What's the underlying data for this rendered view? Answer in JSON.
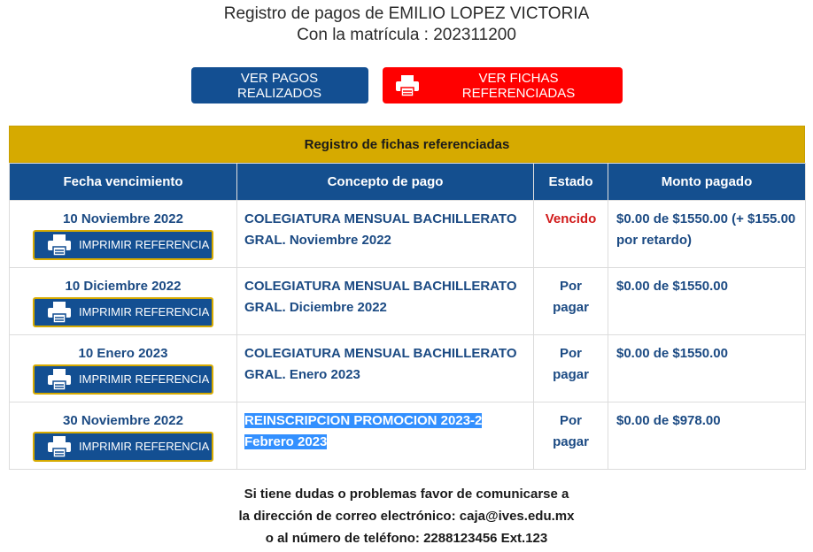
{
  "header": {
    "line1": "Registro de pagos de EMILIO LOPEZ VICTORIA",
    "line2": "Con la matrícula : 202311200"
  },
  "buttons": {
    "ver_pagos": "VER PAGOS REALIZADOS",
    "ver_fichas": "VER FICHAS REFERENCIADAS"
  },
  "table": {
    "caption": "Registro de fichas referenciadas",
    "columns": [
      "Fecha vencimiento",
      "Concepto de pago",
      "Estado",
      "Monto pagado"
    ],
    "print_label": "IMPRIMIR REFERENCIA",
    "rows": [
      {
        "fecha": "10 Noviembre 2022",
        "concepto_1": "COLEGIATURA MENSUAL BACHILLERATO",
        "concepto_2": "GRAL. Noviembre 2022",
        "estado": "Vencido",
        "estado_2": "",
        "monto": "$0.00 de $1550.00 (+ $155.00 por retardo)"
      },
      {
        "fecha": "10 Diciembre 2022",
        "concepto_1": "COLEGIATURA MENSUAL BACHILLERATO",
        "concepto_2": "GRAL. Diciembre 2022",
        "estado": "Por",
        "estado_2": "pagar",
        "monto": "$0.00 de $1550.00"
      },
      {
        "fecha": "10 Enero 2023",
        "concepto_1": "COLEGIATURA MENSUAL BACHILLERATO",
        "concepto_2": "GRAL. Enero 2023",
        "estado": "Por",
        "estado_2": "pagar",
        "monto": "$0.00 de $1550.00"
      },
      {
        "fecha": "30 Noviembre 2022",
        "concepto_1": "REINSCRIPCION PROMOCION 2023-2",
        "concepto_2": "Febrero 2023",
        "estado": "Por",
        "estado_2": "pagar",
        "monto": "$0.00 de $978.00"
      }
    ]
  },
  "footer": {
    "line1": "Si tiene dudas o problemas favor de comunicarse a",
    "line2": "la dirección de correo electrónico: caja@ives.edu.mx",
    "line3": "o al número de teléfono: 2288123456 Ext.123"
  },
  "colors": {
    "primary": "#134f92",
    "gold": "#d6aa00",
    "danger": "#ff0000",
    "overdue_text": "#d11a1a",
    "selection": "#3390ff"
  },
  "icons": {
    "printer": "printer-icon"
  }
}
